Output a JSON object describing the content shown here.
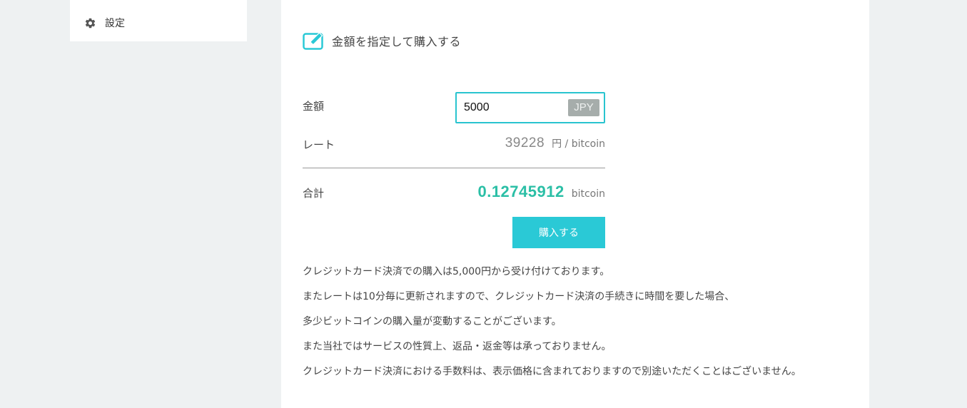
{
  "sidebar": {
    "items": [
      {
        "label": "設定",
        "icon": "gear-icon"
      }
    ]
  },
  "purchase": {
    "title": "金額を指定して購入する",
    "title_icon": "edit-icon",
    "amount_label": "金額",
    "amount_value": "5000",
    "currency": "JPY",
    "rate_label": "レート",
    "rate_value": "39228",
    "rate_unit": "円 / bitcoin",
    "total_label": "合計",
    "total_value": "0.12745912",
    "total_unit": "bitcoin",
    "buy_button": "購入する"
  },
  "notes": [
    "クレジットカード決済での購入は5,000円から受け付けております。",
    "またレートは10分毎に更新されますので、クレジットカード決済の手続きに時間を要した場合、",
    "多少ビットコインの購入量が変動することがございます。",
    "また当社ではサービスの性質上、返品・返金等は承っておりません。",
    "クレジットカード決済における手数料は、表示価格に含まれておりますので別途いただくことはございません。"
  ],
  "colors": {
    "accent": "#2ac9d6",
    "total": "#2bbfa6",
    "background": "#eef1f2",
    "badge": "#a6adab"
  }
}
